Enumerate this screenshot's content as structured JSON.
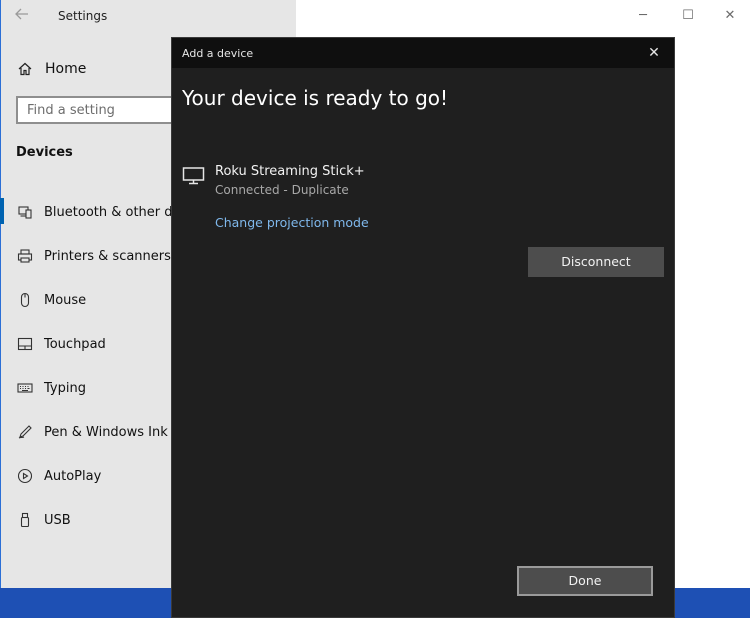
{
  "settings_window": {
    "title": "Settings",
    "back_icon": "back-arrow-icon",
    "window_controls": {
      "minimize": "─",
      "maximize": "☐",
      "close": "✕"
    }
  },
  "sidebar": {
    "home_label": "Home",
    "search_placeholder": "Find a setting",
    "section_title": "Devices",
    "items": [
      {
        "label": "Bluetooth & other de",
        "icon": "bluetooth-device-icon",
        "selected": true
      },
      {
        "label": "Printers & scanners",
        "icon": "printer-icon",
        "selected": false
      },
      {
        "label": "Mouse",
        "icon": "mouse-icon",
        "selected": false
      },
      {
        "label": "Touchpad",
        "icon": "touchpad-icon",
        "selected": false
      },
      {
        "label": "Typing",
        "icon": "keyboard-icon",
        "selected": false
      },
      {
        "label": "Pen & Windows Ink",
        "icon": "pen-icon",
        "selected": false
      },
      {
        "label": "AutoPlay",
        "icon": "autoplay-icon",
        "selected": false
      },
      {
        "label": "USB",
        "icon": "usb-icon",
        "selected": false
      }
    ]
  },
  "dialog": {
    "title": "Add a device",
    "close_glyph": "✕",
    "heading": "Your device is ready to go!",
    "device": {
      "name": "Roku Streaming Stick+",
      "status": "Connected - Duplicate",
      "icon": "monitor-icon"
    },
    "change_mode_link": "Change projection mode",
    "disconnect_label": "Disconnect",
    "done_label": "Done"
  },
  "colors": {
    "dialog_bg": "#1f1f1f",
    "dialog_titlebar": "#0f0f0f",
    "link": "#7fb8ec",
    "button_bg": "#4d4d4d",
    "sidebar_bg": "#e6e6e6",
    "desktop": "#1e50b4",
    "selection_accent": "#0063b1"
  }
}
